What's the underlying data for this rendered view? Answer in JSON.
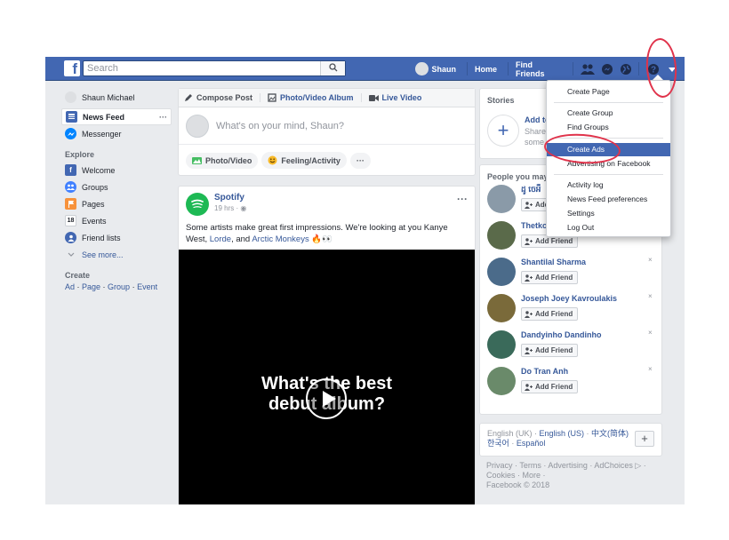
{
  "topbar": {
    "logo": "f",
    "search_placeholder": "Search",
    "profile_name": "Shaun",
    "home": "Home",
    "find_friends": "Find Friends"
  },
  "left": {
    "profile": "Shaun Michael",
    "news_feed": "News Feed",
    "messenger": "Messenger",
    "explore_label": "Explore",
    "explore_items": [
      "Welcome",
      "Groups",
      "Pages",
      "Events",
      "Friend lists"
    ],
    "events_day": "18",
    "see_more": "See more...",
    "create_label": "Create",
    "create_links": [
      "Ad",
      "Page",
      "Group",
      "Event"
    ],
    "dots": "···"
  },
  "composer": {
    "tabs": [
      "Compose Post",
      "Photo/Video Album",
      "Live Video"
    ],
    "placeholder": "What's on your mind, Shaun?",
    "actions": [
      "Photo/Video",
      "Feeling/Activity"
    ],
    "more": "···"
  },
  "post": {
    "page_name": "Spotify",
    "time": "19 hrs ·",
    "menu": "···",
    "text_before": "Some artists make great first impressions. We're looking at you Kanye West, ",
    "link1": "Lorde",
    "text_mid": ", and ",
    "link2": "Arctic Monkeys",
    "emoji": "🔥👀",
    "video_line1": "What's the best",
    "video_line2": "debut album?"
  },
  "stories": {
    "title": "Stories",
    "add_label": "Add to",
    "sub": "Share some"
  },
  "pymk": {
    "title": "People you may",
    "add_friend": "Add Friend",
    "close": "×",
    "people": [
      {
        "name": "ដូ ចេអឺ",
        "color": "#8a9aa8"
      },
      {
        "name": "Thetko",
        "color": "#5a6a4a"
      },
      {
        "name": "Shantilal Sharma",
        "color": "#4b6b8a"
      },
      {
        "name": "Joseph Joey Kavroulakis",
        "color": "#7a6a3a"
      },
      {
        "name": "Dandyinho Dandinho",
        "color": "#3a6a5a"
      },
      {
        "name": "Do Tran Anh",
        "color": "#6a8a6a"
      }
    ]
  },
  "lang": {
    "line1": [
      "English (UK)",
      "English (US)",
      "中文(简体)"
    ],
    "line2": [
      "한국어",
      "Español"
    ],
    "plus": "+"
  },
  "footer": {
    "line1": "Privacy · Terms · Advertising · AdChoices ▷ ·",
    "line2": "Cookies · More ·",
    "line3": "Facebook © 2018"
  },
  "dropdown": {
    "items": [
      "Create Page",
      "Create Group",
      "Find Groups",
      "Create Ads",
      "Advertising on Facebook",
      "Activity log",
      "News Feed preferences",
      "Settings",
      "Log Out"
    ]
  },
  "colors": {
    "brand": "#4267b2",
    "highlight_ring": "#e0334b"
  }
}
